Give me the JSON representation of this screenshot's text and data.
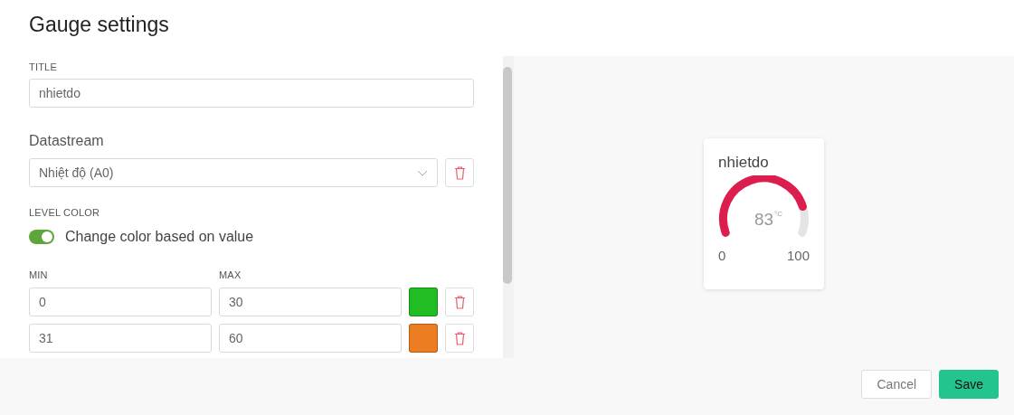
{
  "title": "Gauge settings",
  "title_field": {
    "label": "TITLE",
    "value": "nhietdo"
  },
  "datastream": {
    "label": "Datastream",
    "value": "Nhiệt độ (A0)"
  },
  "level_color": {
    "label": "LEVEL COLOR",
    "toggle_label": "Change color based on value",
    "on": true
  },
  "ranges": {
    "min_label": "MIN",
    "max_label": "MAX",
    "rows": [
      {
        "min": "0",
        "max": "30",
        "color": "#22bd22"
      },
      {
        "min": "31",
        "max": "60",
        "color": "#ec7d22"
      }
    ]
  },
  "preview": {
    "title": "nhietdo",
    "value": "83",
    "unit": "°C",
    "min": "0",
    "max": "100"
  },
  "buttons": {
    "cancel": "Cancel",
    "save": "Save"
  }
}
